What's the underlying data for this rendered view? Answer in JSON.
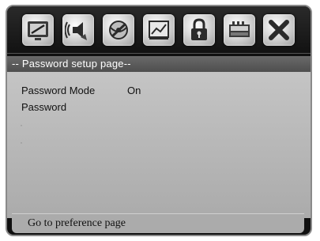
{
  "toolbar": {
    "icons": [
      {
        "name": "general-setup-icon"
      },
      {
        "name": "audio-setup-icon"
      },
      {
        "name": "video-setup-icon"
      },
      {
        "name": "preference-icon"
      },
      {
        "name": "password-lock-icon"
      },
      {
        "name": "digital-setup-icon"
      },
      {
        "name": "exit-icon"
      }
    ]
  },
  "page": {
    "title": "-- Password setup page--"
  },
  "settings": {
    "password_mode_label": "Password Mode",
    "password_mode_value": "On",
    "password_label": "Password"
  },
  "footer": {
    "hint": "Go to preference page"
  },
  "colors": {
    "panel_bg": "#b4b4b4",
    "title_bg": "#5a5a5a",
    "frame_bg": "#101010"
  }
}
